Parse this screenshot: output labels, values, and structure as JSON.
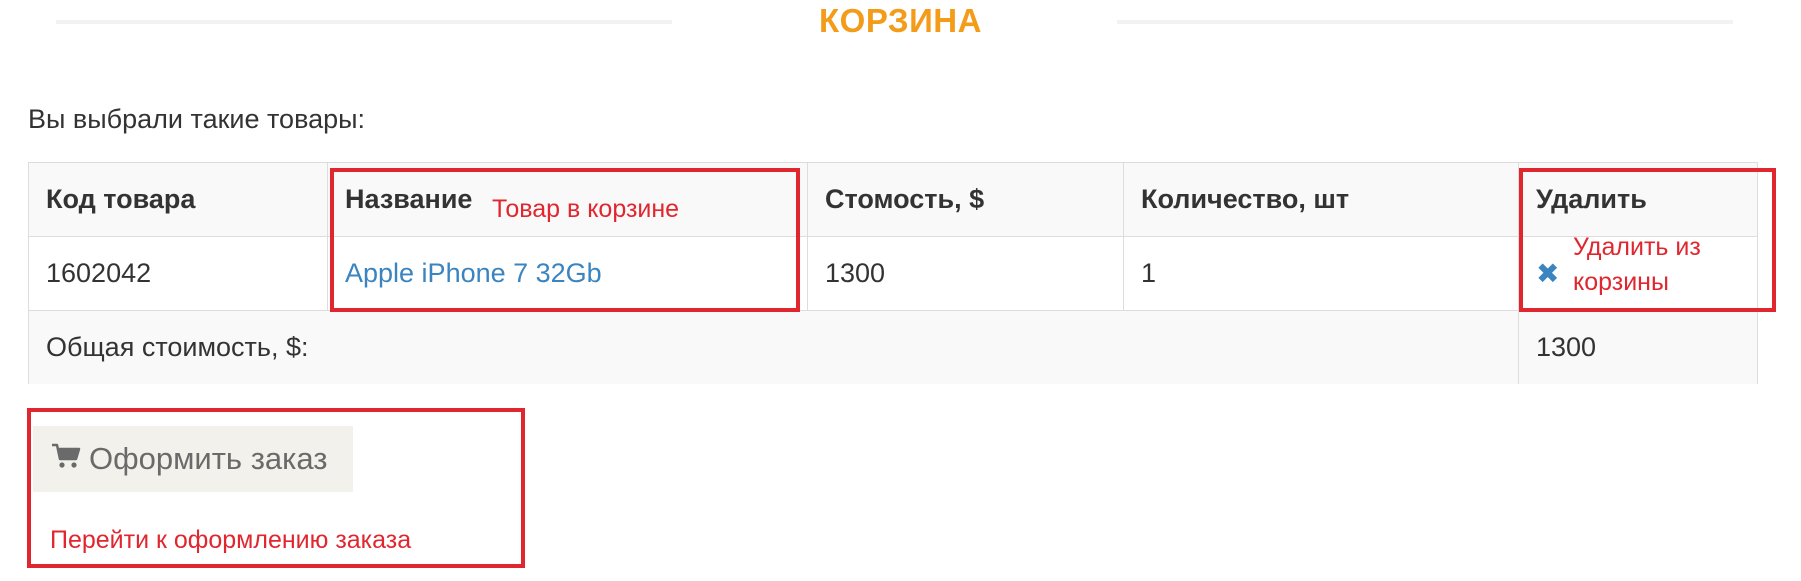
{
  "page": {
    "title": "КОРЗИНА",
    "intro": "Вы выбрали такие товары:"
  },
  "table": {
    "headers": {
      "code": "Код товара",
      "name": "Название",
      "price": "Стомость, $",
      "qty": "Количество, шт",
      "remove": "Удалить"
    },
    "item": {
      "code": "1602042",
      "name": "Apple iPhone 7 32Gb",
      "price": "1300",
      "qty": "1",
      "remove_icon": "close-icon"
    },
    "total": {
      "label": "Общая стоимость, $:",
      "value": "1300"
    }
  },
  "checkout": {
    "label": "Оформить заказ",
    "icon": "cart-icon"
  },
  "annotations": {
    "cart_item": "Товар в корзине",
    "remove_line1": "Удалить из",
    "remove_line2": "корзины",
    "checkout": "Перейти к оформлению заказа"
  },
  "colors": {
    "title": "#f39c1a",
    "link": "#3a84c0",
    "annotation": "#e0262e",
    "button_bg": "#f2f1eb"
  }
}
